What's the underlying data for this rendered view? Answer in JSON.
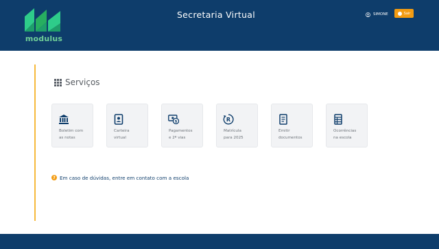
{
  "header": {
    "brand": "modulus",
    "title": "Secretaria Virtual",
    "user_name": "SIMONE",
    "logout_label": "Sair"
  },
  "main": {
    "section_title": "Serviços",
    "services": [
      {
        "label": "Boletim com\nas notas",
        "icon": "bank-icon"
      },
      {
        "label": "Carteira\nvirtual",
        "icon": "id-card-icon"
      },
      {
        "label": "Pagamentos\ne 2ª vias",
        "icon": "payment-icon"
      },
      {
        "label": "Matrícula\npara 2025",
        "icon": "registration-icon"
      },
      {
        "label": "Emitir\ndocumentos",
        "icon": "document-icon"
      },
      {
        "label": "Ocorrências\nna escola",
        "icon": "list-icon"
      }
    ],
    "help_text": "Em caso de dúvidas, entre em contato com a escola"
  },
  "colors": {
    "header_bg": "#0e3d6b",
    "accent": "#f39c12",
    "logo_green": "#2ecc8a"
  }
}
